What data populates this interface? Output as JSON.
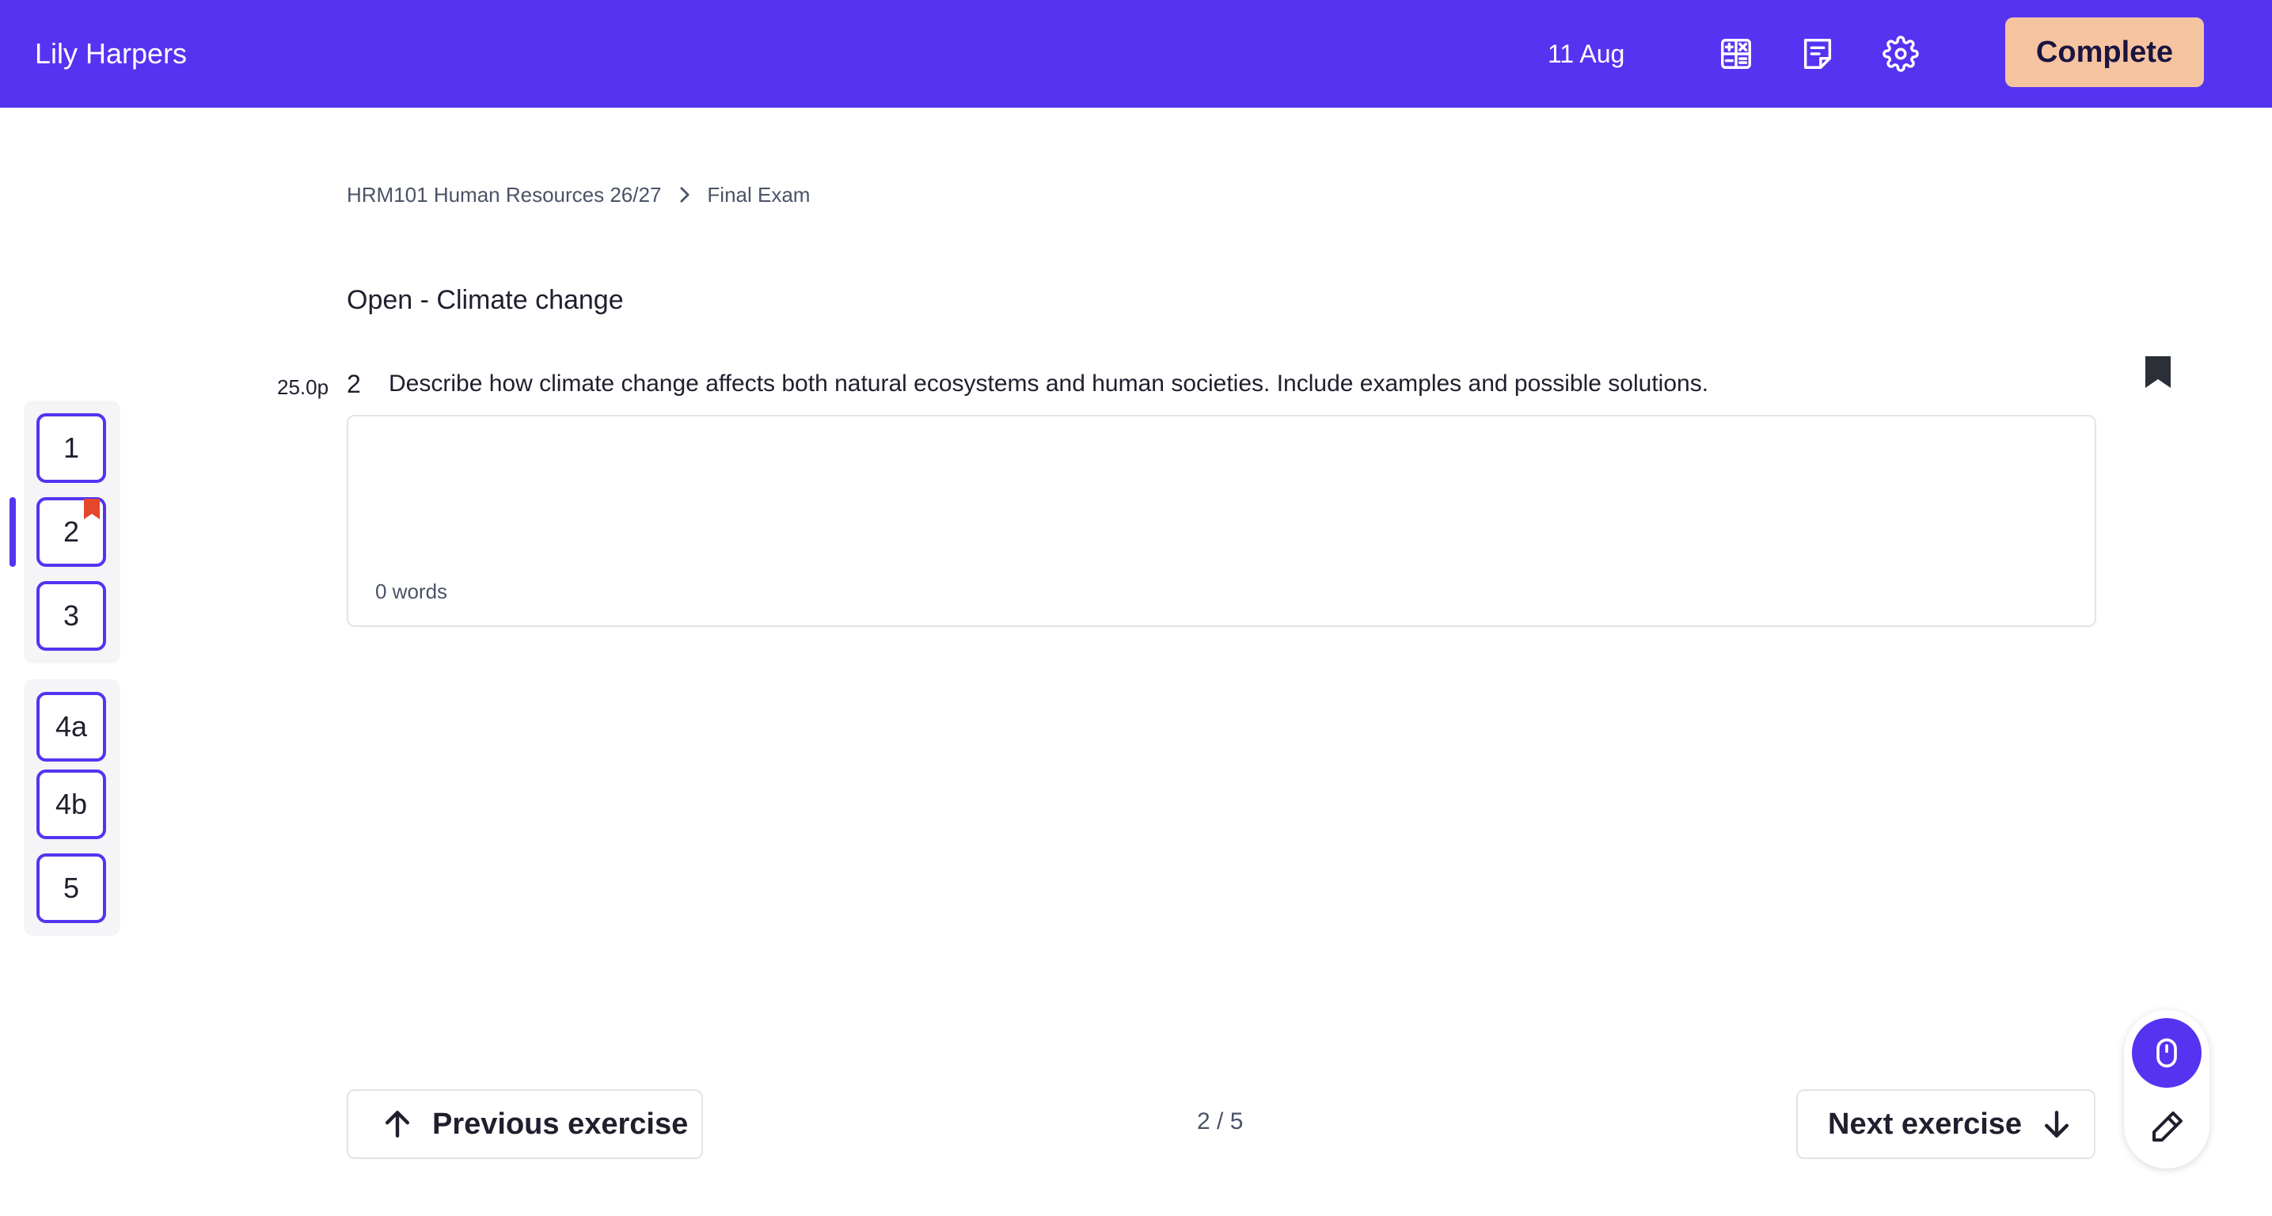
{
  "header": {
    "user_name": "Lily Harpers",
    "date": "11 Aug",
    "icons": [
      "calculator-icon",
      "notes-icon",
      "gear-icon"
    ],
    "complete_label": "Complete",
    "background_color": "#5533f1",
    "complete_color": "#f6c3a0"
  },
  "breadcrumb": {
    "course": "HRM101 Human Resources 26/27",
    "exam": "Final Exam"
  },
  "exercise": {
    "title": "Open - Climate change",
    "points": "25.0p",
    "number": "2",
    "question": "Describe how climate change affects both natural ecosystems and human societies. Include examples and possible solutions.",
    "answer_value": "",
    "word_count": "0 words"
  },
  "question_nav": {
    "groups": [
      [
        "1",
        "2",
        "3"
      ],
      [
        "4a",
        "4b",
        "5"
      ]
    ],
    "active": "2",
    "flagged": [
      "2"
    ],
    "accent_color": "#5533f1",
    "flag_color": "#e5472d"
  },
  "footer": {
    "previous_label": "Previous exercise",
    "next_label": "Next exercise",
    "pager": "2 / 5"
  },
  "tools": {
    "items": [
      "mouse-icon",
      "pen-icon"
    ],
    "active": "mouse-icon"
  }
}
